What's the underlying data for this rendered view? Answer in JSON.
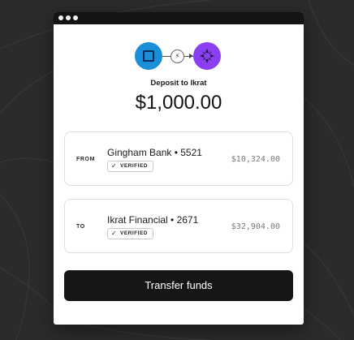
{
  "transfer": {
    "title": "Deposit to Ikrat",
    "amount": "$1,000.00",
    "flow_icon": "lightning-icon"
  },
  "source": {
    "label": "FROM",
    "account": "Gingham Bank • 5521",
    "badge": "VERIFIED",
    "balance": "$10,324.00"
  },
  "destination": {
    "label": "TO",
    "account": "Ikrat Financial • 2671",
    "badge": "VERIFIED",
    "balance": "$32,904.00"
  },
  "actions": {
    "transfer_label": "Transfer funds"
  },
  "colors": {
    "bank_logo": "#1a8fd8",
    "ikrat_logo": "#8a3ff0",
    "button": "#161616",
    "background": "#2b2b2b"
  }
}
